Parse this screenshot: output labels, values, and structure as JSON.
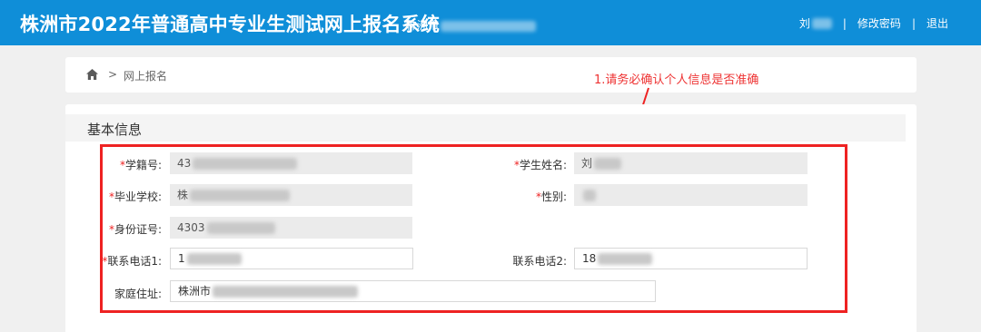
{
  "header": {
    "title": "株洲市2022年普通高中专业生测试网上报名系统",
    "region": "株洲市",
    "user": "刘",
    "sep1": "|",
    "change_password": "修改密码",
    "sep2": "|",
    "logout": "退出"
  },
  "breadcrumb": {
    "separator": ">",
    "current": "网上报名"
  },
  "annotation": "1.请务必确认个人信息是否准确",
  "panel": {
    "title": "基本信息"
  },
  "form": {
    "student_id": {
      "required": "*",
      "label": "学籍号:",
      "value": "43"
    },
    "student_name": {
      "required": "*",
      "label": "学生姓名:",
      "value": "刘"
    },
    "school": {
      "required": "*",
      "label": "毕业学校:",
      "value": "株"
    },
    "gender": {
      "required": "*",
      "label": "性别:",
      "value": ""
    },
    "id_card": {
      "required": "*",
      "label": "身份证号:",
      "value": "4303"
    },
    "phone1": {
      "required": "*",
      "label": "联系电话1:",
      "value": "1"
    },
    "phone2": {
      "label": "联系电话2:",
      "value": "18"
    },
    "address": {
      "label": "家庭住址:",
      "value": "株洲市"
    }
  },
  "colors": {
    "topbar": "#0f8ed8",
    "accent_red": "#ee2222",
    "page_bg": "#f0f0f0"
  }
}
